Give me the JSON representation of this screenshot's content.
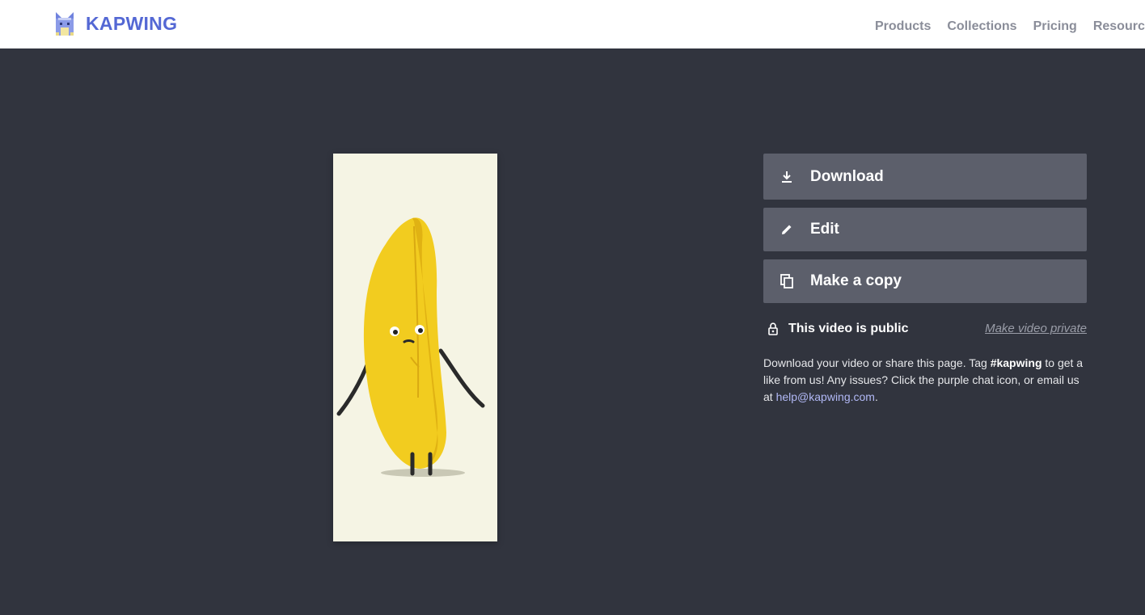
{
  "header": {
    "brand": "KAPWING",
    "nav": [
      "Products",
      "Collections",
      "Pricing",
      "Resources"
    ]
  },
  "actions": {
    "download": "Download",
    "edit": "Edit",
    "copy": "Make a copy"
  },
  "privacy": {
    "status": "This video is public",
    "toggle": "Make video private"
  },
  "help": {
    "part1": "Download your video or share this page. Tag ",
    "tag": "#kapwing",
    "part2": " to get a like from us! Any issues? Click the purple chat icon, or email us at ",
    "email": "help@kapwing.com",
    "part3": "."
  },
  "icons": {
    "download": "download-icon",
    "edit": "pencil-icon",
    "copy": "copy-icon",
    "privacy": "lock-icon",
    "logo": "kapwing-cat-logo"
  },
  "colors": {
    "background": "#31343e",
    "header": "#ffffff",
    "brand": "#5468d4",
    "button": "#5c5f6b",
    "link": "#b1b8f5",
    "preview_bg": "#f5f4e4"
  }
}
